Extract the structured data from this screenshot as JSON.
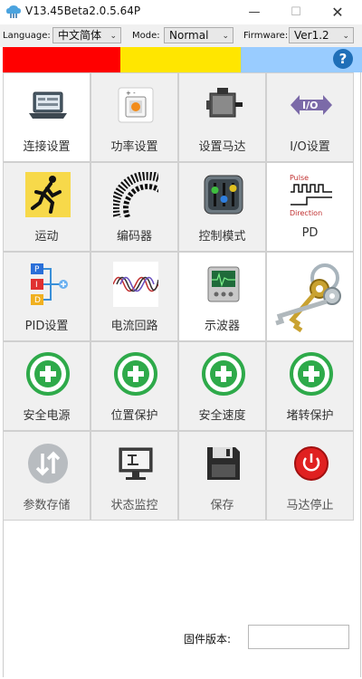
{
  "window": {
    "title": "V13.45Beta2.0.5.64P",
    "minimize": "—",
    "maximize": "☐",
    "close": "✕"
  },
  "toolbar": {
    "language_label": "Language:",
    "language_value": "中文简体",
    "mode_label": "Mode:",
    "mode_value": "Normal",
    "firmware_label": "Firmware:",
    "firmware_value": "Ver1.2"
  },
  "status_colors": {
    "red": "#ff0000",
    "yellow": "#ffe600",
    "blue": "#99ccff"
  },
  "help": {
    "label": "?"
  },
  "tiles": [
    {
      "label": "连接设置",
      "icon": "laptop-icon"
    },
    {
      "label": "功率设置",
      "icon": "battery-icon"
    },
    {
      "label": "设置马达",
      "icon": "motor-icon"
    },
    {
      "label": "I/O设置",
      "icon": "io-icon"
    },
    {
      "label": "运动",
      "icon": "runner-icon"
    },
    {
      "label": "编码器",
      "icon": "encoder-icon"
    },
    {
      "label": "控制模式",
      "icon": "control-mode-icon"
    },
    {
      "label": "PD",
      "icon": "pulse-direction-icon",
      "icon_text_top": "Pulse",
      "icon_text_bottom": "Direction"
    },
    {
      "label": "PID设置",
      "icon": "pid-icon",
      "icon_letters": [
        "P",
        "I",
        "D"
      ]
    },
    {
      "label": "电流回路",
      "icon": "sine-wave-icon"
    },
    {
      "label": "示波器",
      "icon": "oscilloscope-icon"
    },
    {
      "label": "",
      "icon": "keys-icon"
    },
    {
      "label": "安全电源",
      "icon": "safety-cross-icon"
    },
    {
      "label": "位置保护",
      "icon": "safety-cross-icon"
    },
    {
      "label": "安全速度",
      "icon": "safety-cross-icon"
    },
    {
      "label": "堵转保护",
      "icon": "safety-cross-icon"
    },
    {
      "label": "参数存储",
      "icon": "transfer-arrows-icon"
    },
    {
      "label": "状态监控",
      "icon": "monitor-icon"
    },
    {
      "label": "保存",
      "icon": "floppy-icon"
    },
    {
      "label": "马达停止",
      "icon": "power-stop-icon"
    }
  ],
  "firmware": {
    "label": "固件版本:",
    "value": ""
  }
}
